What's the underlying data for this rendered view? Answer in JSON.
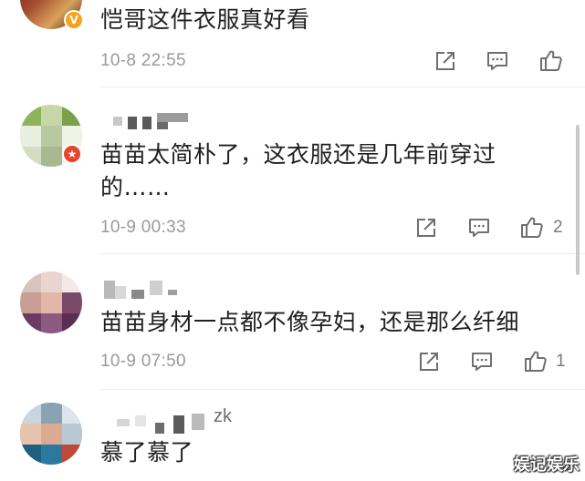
{
  "comments": [
    {
      "username": "",
      "text": "恺哥这件衣服真好看",
      "time": "10-8 22:55",
      "likes": "",
      "badge": "V"
    },
    {
      "username": "",
      "text": "苗苗太简朴了，这衣服还是几年前穿过的……",
      "time": "10-9 00:33",
      "likes": "2",
      "badge": "★"
    },
    {
      "username": "",
      "text": "苗苗身材一点都不像孕妇，还是那么纤细",
      "time": "10-9 07:50",
      "likes": "1",
      "badge": ""
    },
    {
      "username": "zk",
      "text": "慕了慕了",
      "time": "",
      "likes": "",
      "badge": ""
    }
  ],
  "icons": {
    "share": "share-icon",
    "reply": "comment-icon",
    "like": "thumbs-up-icon"
  },
  "watermark": "娱记娱乐",
  "colors": {
    "text": "#1f1f1f",
    "meta": "#9a9a9a",
    "verified_badge": "#f7a21b",
    "member_badge": "#e8432d"
  }
}
